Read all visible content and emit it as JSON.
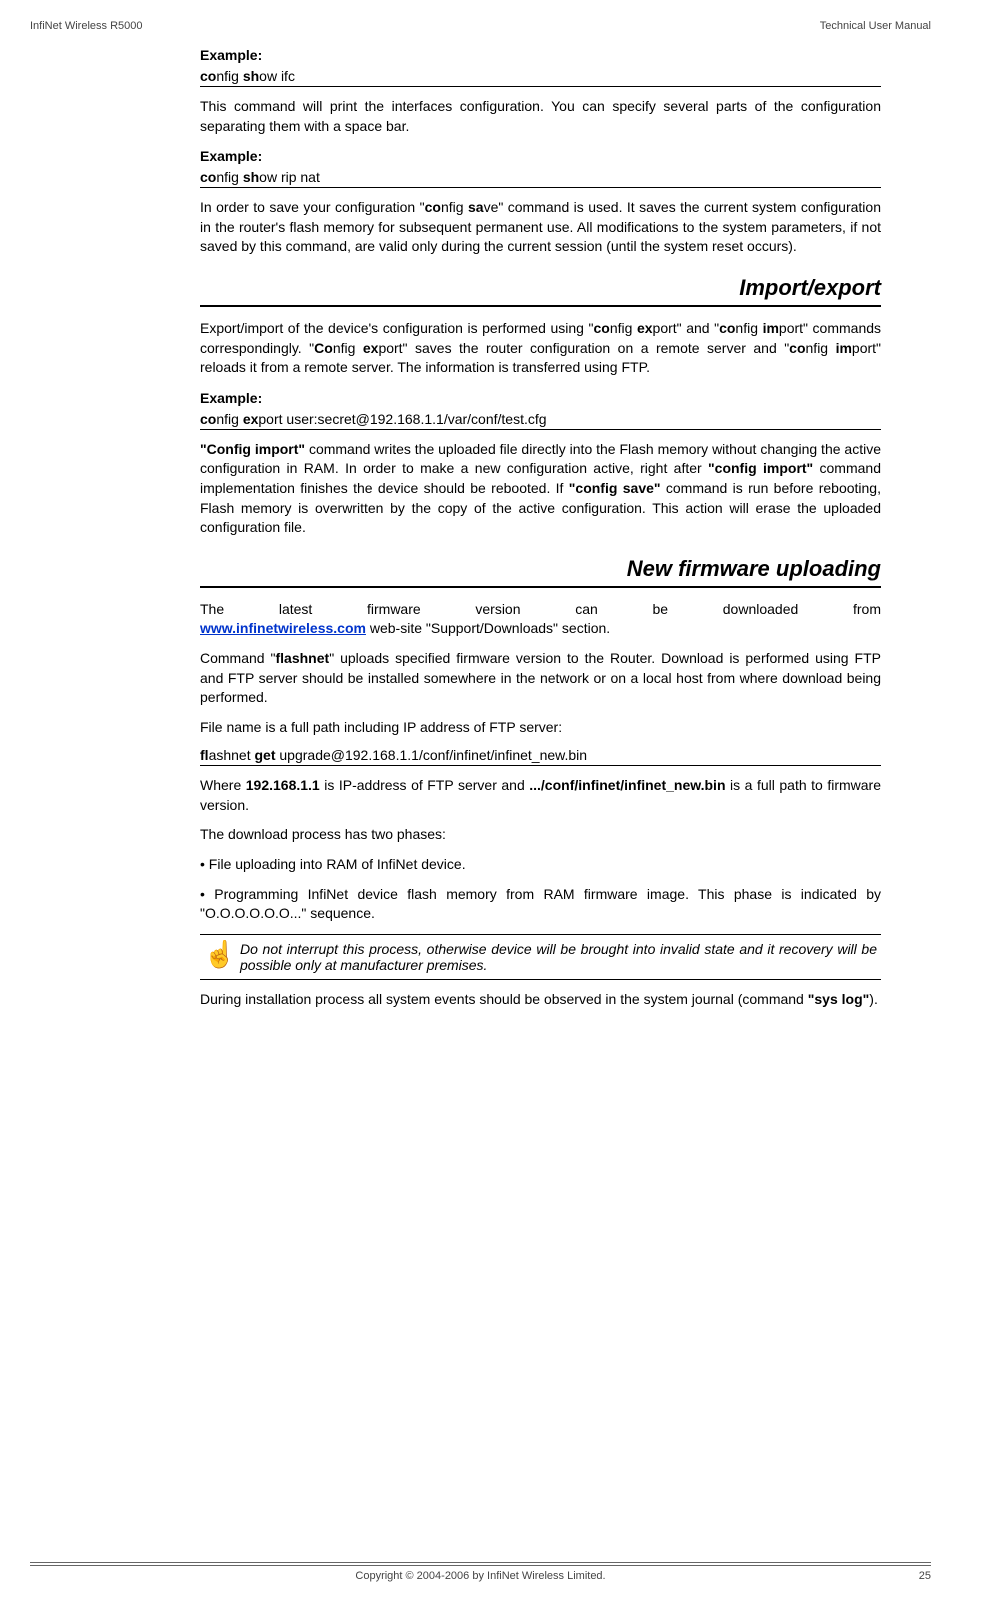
{
  "header": {
    "left": "InfiNet Wireless R5000",
    "right": "Technical User Manual"
  },
  "body": {
    "example1_label": "Example:",
    "code1_bold1": "co",
    "code1_text1": "nfig ",
    "code1_bold2": "sh",
    "code1_text2": "ow ifc",
    "para1": "This command will print the interfaces configuration. You can specify several parts of the configuration separating them with a space bar.",
    "example2_label": "Example:",
    "code2_bold1": "co",
    "code2_text1": "nfig ",
    "code2_bold2": "sh",
    "code2_text2": "ow rip nat",
    "para2_pre": "In order to save your configuration \"",
    "para2_b1": "co",
    "para2_t1": "nfig ",
    "para2_b2": "sa",
    "para2_post": "ve\" command is used. It saves the current system configuration in the router's flash memory for subsequent permanent use. All modifications to the system parameters, if not saved by this command, are valid only during the current session (until the system reset occurs).",
    "section1_title": "Import/export",
    "para3_t1": "Export/import of the device's configuration is performed using \"",
    "para3_b1": "co",
    "para3_t2": "nfig ",
    "para3_b2": "ex",
    "para3_t3": "port\" and \"",
    "para3_b3": "co",
    "para3_t4": "nfig ",
    "para3_b4": "im",
    "para3_t5": "port\" commands correspondingly. \"",
    "para3_b5": "Co",
    "para3_t6": "nfig ",
    "para3_b6": "ex",
    "para3_t7": "port\" saves the router configuration on a remote server and \"",
    "para3_b7": "co",
    "para3_t8": "nfig ",
    "para3_b8": "im",
    "para3_t9": "port\" reloads it from a remote server. The information is transferred using FTP.",
    "example3_label": "Example:",
    "code3_b1": "co",
    "code3_t1": "nfig ",
    "code3_b2": "ex",
    "code3_t2": "port user:secret@192.168.1.1/var/conf/test.cfg",
    "para4_b1": "\"Config import\"",
    "para4_t1": " command writes the uploaded file directly into the Flash memory without changing the active configuration in RAM. In order to make a new configuration active, right after ",
    "para4_b2": "\"config import\"",
    "para4_t2": " command implementation finishes the device should be rebooted. If ",
    "para4_b3": "\"config save\"",
    "para4_t3": " command is run before rebooting, Flash memory is overwritten by the copy of the active configuration. This action will erase the uploaded configuration file.",
    "section2_title": "New firmware uploading",
    "para5_t1": "The latest firmware version can be downloaded from ",
    "para5_link": "www.infinetwireless.com",
    "para5_t2": " web-site \"Support/Downloads\" section.",
    "para6_t1": "Command \"",
    "para6_b1": "flashnet",
    "para6_t2": "\" uploads specified firmware version to the Router. Download is performed using FTP and FTP server should be installed somewhere in the network or on a local host from where download being performed.",
    "para7": "File name is a full path including IP address of FTP server:",
    "code4_b1": "fl",
    "code4_t1": "ashnet ",
    "code4_b2": "get",
    "code4_t2": " upgrade@192.168.1.1/conf/infinet/infinet_new.bin",
    "para8_t1": "Where ",
    "para8_b1": "192.168.1.1",
    "para8_t2": " is IP-address of FTP server and ",
    "para8_b2": ".../conf/infinet/infinet_new.bin",
    "para8_t3": " is a full path to firmware version.",
    "para9": "The download process has two phases:",
    "para10": "• File uploading into RAM of InfiNet device.",
    "para11": "• Programming InfiNet device flash memory from RAM firmware image. This phase is indicated by \"O.O.O.O.O.O...\" sequence.",
    "note_text": "Do not interrupt this process, otherwise device will be brought into invalid state and it recovery will be possible only at manufacturer premises.",
    "para12_t1": "During installation process all system events should be observed in the system journal (command ",
    "para12_b1": "\"sys log\"",
    "para12_t2": ").",
    "note_icon": "☝"
  },
  "footer": {
    "copyright": "Copyright © 2004-2006 by InfiNet Wireless Limited.",
    "page": "25"
  }
}
